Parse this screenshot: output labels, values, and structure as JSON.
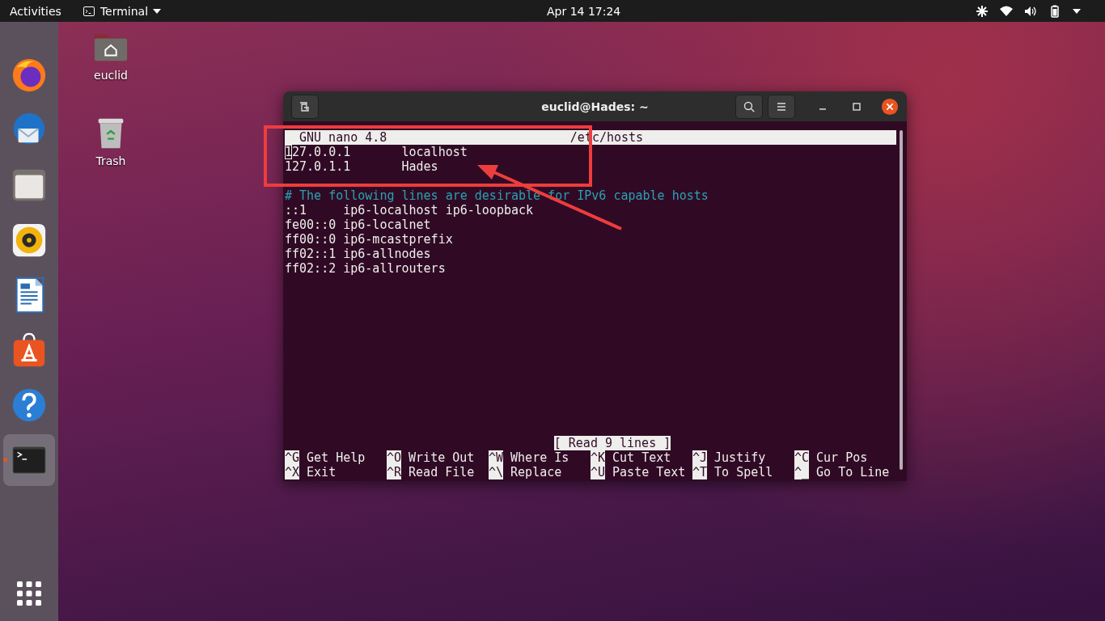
{
  "top_bar": {
    "activities": "Activities",
    "app_menu": "Terminal",
    "clock": "Apr 14  17:24"
  },
  "dock": [
    {
      "kind": "browser",
      "active": false
    },
    {
      "kind": "mail",
      "active": false
    },
    {
      "kind": "files",
      "active": false
    },
    {
      "kind": "music",
      "active": false
    },
    {
      "kind": "writer",
      "active": false
    },
    {
      "kind": "software",
      "active": false
    },
    {
      "kind": "help",
      "active": false
    },
    {
      "kind": "terminal",
      "active": true
    }
  ],
  "desktop_icons": [
    {
      "kind": "home",
      "label": "euclid"
    },
    {
      "kind": "trash",
      "label": "Trash"
    }
  ],
  "window": {
    "title": "euclid@Hades: ~",
    "editor": {
      "app": "GNU nano 4.8",
      "file": "/etc/hosts",
      "blocks": [
        {
          "lines": [
            {
              "text": "127.0.0.1       localhost",
              "kind": "plain",
              "cursor": true
            },
            {
              "text": "127.0.1.1       Hades",
              "kind": "plain",
              "cursor": false
            }
          ]
        },
        {
          "lines": [
            {
              "text": "# The following lines are desirable for IPv6 capable hosts",
              "kind": "comment",
              "cursor": false
            },
            {
              "text": "::1     ip6-localhost ip6-loopback",
              "kind": "plain",
              "cursor": false
            },
            {
              "text": "fe00::0 ip6-localnet",
              "kind": "plain",
              "cursor": false
            },
            {
              "text": "ff00::0 ip6-mcastprefix",
              "kind": "plain",
              "cursor": false
            },
            {
              "text": "ff02::1 ip6-allnodes",
              "kind": "plain",
              "cursor": false
            },
            {
              "text": "ff02::2 ip6-allrouters",
              "kind": "plain",
              "cursor": false
            }
          ]
        }
      ],
      "status": "[ Read 9 lines ]",
      "shortcuts": [
        {
          "key": "^G",
          "label": "Get Help"
        },
        {
          "key": "^O",
          "label": "Write Out"
        },
        {
          "key": "^W",
          "label": "Where Is"
        },
        {
          "key": "^K",
          "label": "Cut Text"
        },
        {
          "key": "^J",
          "label": "Justify"
        },
        {
          "key": "^C",
          "label": "Cur Pos"
        },
        {
          "key": "^X",
          "label": "Exit"
        },
        {
          "key": "^R",
          "label": "Read File"
        },
        {
          "key": "^\\",
          "label": "Replace"
        },
        {
          "key": "^U",
          "label": "Paste Text"
        },
        {
          "key": "^T",
          "label": "To Spell"
        },
        {
          "key": "^_",
          "label": "Go To Line"
        }
      ]
    }
  }
}
